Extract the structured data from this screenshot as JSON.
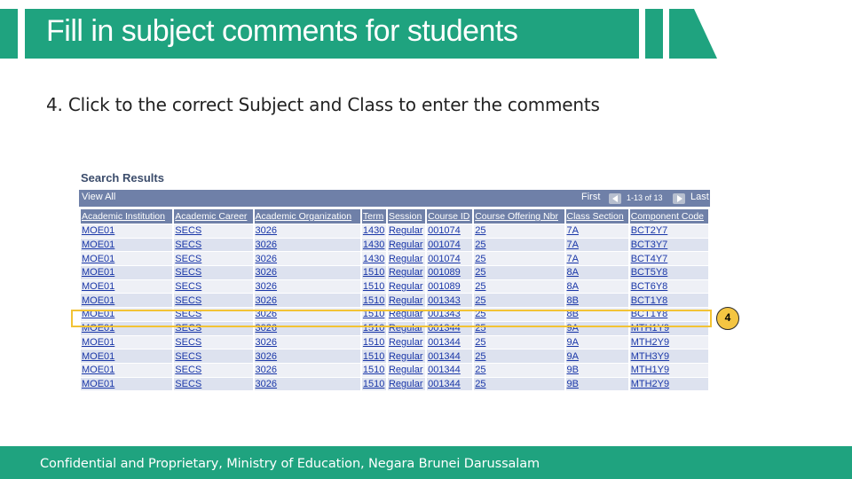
{
  "slide": {
    "title": "Fill in subject comments for students",
    "instruction": "4. Click to the correct Subject and Class to enter the comments",
    "footer": "Confidential and Proprietary, Ministry of Education, Negara Brunei Darussalam",
    "callout_number": "4",
    "accent_color": "#1fa37f",
    "highlight_color": "#f2c335"
  },
  "search_results": {
    "heading": "Search Results",
    "view_all": "View All",
    "first": "First",
    "range": "1-13 of 13",
    "last": "Last",
    "columns": [
      "Academic Institution",
      "Academic Career",
      "Academic Organization",
      "Term",
      "Session",
      "Course ID",
      "Course Offering Nbr",
      "Class Section",
      "Component Code"
    ],
    "rows": [
      [
        "MOE01",
        "SECS",
        "3026",
        "1430",
        "Regular",
        "001074",
        "25",
        "7A",
        "BCT2Y7"
      ],
      [
        "MOE01",
        "SECS",
        "3026",
        "1430",
        "Regular",
        "001074",
        "25",
        "7A",
        "BCT3Y7"
      ],
      [
        "MOE01",
        "SECS",
        "3026",
        "1430",
        "Regular",
        "001074",
        "25",
        "7A",
        "BCT4Y7"
      ],
      [
        "MOE01",
        "SECS",
        "3026",
        "1510",
        "Regular",
        "001089",
        "25",
        "8A",
        "BCT5Y8"
      ],
      [
        "MOE01",
        "SECS",
        "3026",
        "1510",
        "Regular",
        "001089",
        "25",
        "8A",
        "BCT6Y8"
      ],
      [
        "MOE01",
        "SECS",
        "3026",
        "1510",
        "Regular",
        "001343",
        "25",
        "8B",
        "BCT1Y8"
      ],
      [
        "MOE01",
        "SECS",
        "3026",
        "1510",
        "Regular",
        "001343",
        "25",
        "8B",
        "BCT1Y8"
      ],
      [
        "MOE01",
        "SECS",
        "3026",
        "1510",
        "Regular",
        "001344",
        "25",
        "9A",
        "MTH1Y9"
      ],
      [
        "MOE01",
        "SECS",
        "3026",
        "1510",
        "Regular",
        "001344",
        "25",
        "9A",
        "MTH2Y9"
      ],
      [
        "MOE01",
        "SECS",
        "3026",
        "1510",
        "Regular",
        "001344",
        "25",
        "9A",
        "MTH3Y9"
      ],
      [
        "MOE01",
        "SECS",
        "3026",
        "1510",
        "Regular",
        "001344",
        "25",
        "9B",
        "MTH1Y9"
      ],
      [
        "MOE01",
        "SECS",
        "3026",
        "1510",
        "Regular",
        "001344",
        "25",
        "9B",
        "MTH2Y9"
      ]
    ],
    "highlighted_row": 6
  }
}
